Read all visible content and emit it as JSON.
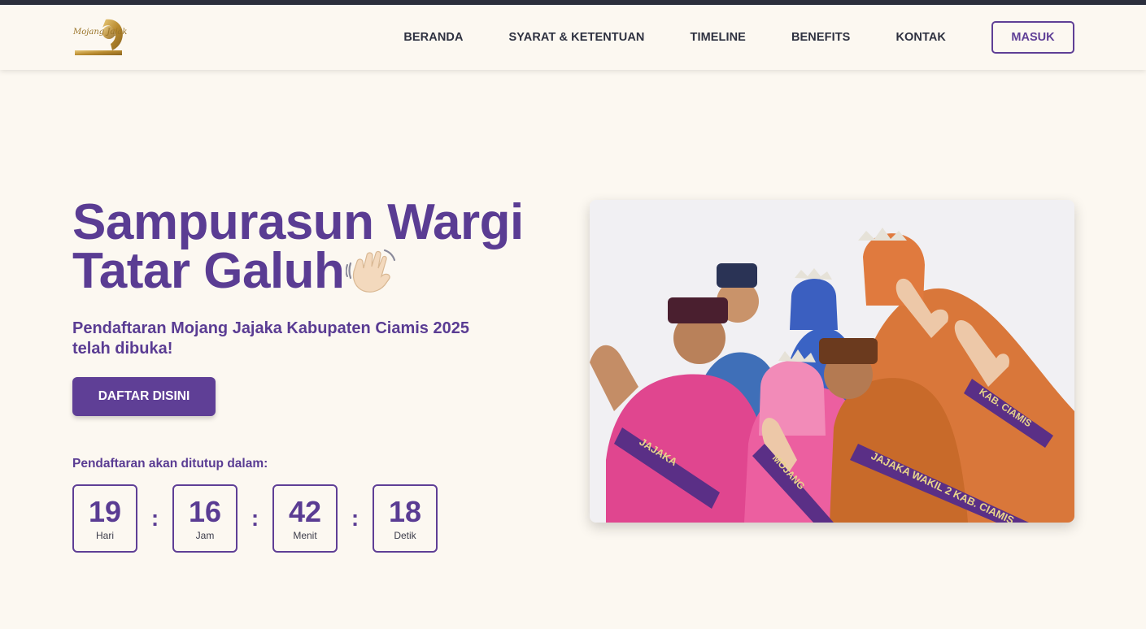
{
  "nav": {
    "items": [
      "BERANDA",
      "SYARAT & KETENTUAN",
      "TIMELINE",
      "BENEFITS",
      "KONTAK"
    ],
    "login_label": "MASUK",
    "logo_text": "Mojang Jajaka"
  },
  "hero": {
    "title_line1": "Sampurasun Wargi",
    "title_line2": "Tatar Galuh",
    "wave_icon": "waving-hand-icon",
    "subtitle": "Pendaftaran Mojang Jajaka Kabupaten Ciamis 2025 telah dibuka!",
    "cta_label": "DAFTAR DISINI"
  },
  "countdown": {
    "label": "Pendaftaran akan ditutup dalam:",
    "separator": ":",
    "units": [
      {
        "value": "19",
        "unit": "Hari"
      },
      {
        "value": "16",
        "unit": "Jam"
      },
      {
        "value": "42",
        "unit": "Menit"
      },
      {
        "value": "18",
        "unit": "Detik"
      }
    ]
  },
  "photo": {
    "sash_texts": [
      "JAJAKA",
      "MOJANG",
      "JAJAKA WAKIL 2 KAB. CIAMIS",
      "KAB. CIAMIS"
    ]
  },
  "colors": {
    "brand_purple": "#5f3f96",
    "title_purple": "#5a3c93",
    "background": "#fcf8f1",
    "topbar": "#2c2f3d",
    "nav_text": "#2e3140"
  }
}
